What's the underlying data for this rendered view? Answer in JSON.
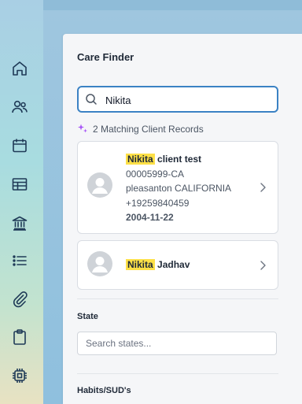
{
  "panel": {
    "title": "Care Finder"
  },
  "search": {
    "value": "Nikita"
  },
  "results": {
    "summary": "2 Matching Client Records",
    "records": [
      {
        "name_highlight": "Nikita",
        "name_rest": "client test",
        "id": "00005999-CA",
        "location": "pleasanton CALIFORNIA",
        "phone": "+19259840459",
        "dob": "2004-11-22"
      },
      {
        "name_highlight": "Nikita",
        "name_rest": "Jadhav"
      }
    ]
  },
  "filters": {
    "state": {
      "label": "State",
      "placeholder": "Search states..."
    },
    "habits": {
      "label": "Habits/SUD's"
    }
  },
  "sidebar": {
    "icons": [
      "home-icon",
      "users-icon",
      "calendar-icon",
      "table-icon",
      "bank-icon",
      "list-icon",
      "paperclip-icon",
      "clipboard-icon",
      "chip-icon"
    ]
  }
}
